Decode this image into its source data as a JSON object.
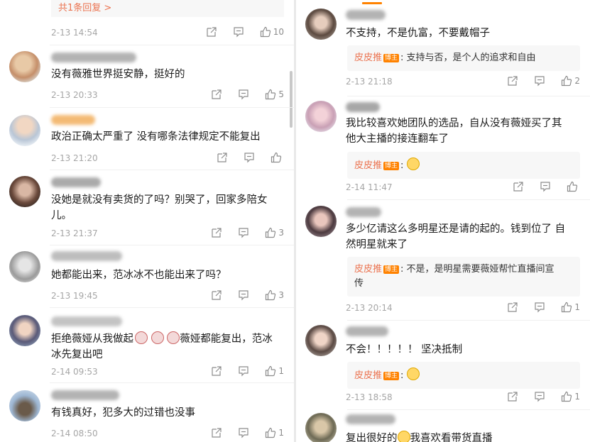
{
  "left": {
    "top_reply_more": "共1条回复 >",
    "top_meta": {
      "time": "2-13 14:54",
      "likes": "10"
    },
    "comments": [
      {
        "text": "没有薇雅世界挺安静，挺好的",
        "time": "2-13 20:33",
        "likes": "5"
      },
      {
        "text": "政治正确太严重了 没有哪条法律规定不能复出",
        "time": "2-13 21:20",
        "likes": ""
      },
      {
        "text": "没她是就没有卖货的了吗？别哭了，回家多陪女\n儿。",
        "time": "2-13 21:37",
        "likes": "3"
      },
      {
        "text": "她都能出来，范冰冰不也能出来了吗？",
        "time": "2-13 19:45",
        "likes": "3"
      },
      {
        "text_pre": "拒绝薇娅从我做起",
        "text_post": "薇娅都能复出，范冰\n冰先复出吧",
        "time": "2-14 09:53",
        "likes": "1"
      },
      {
        "text": "有钱真好，犯多大的过错也没事",
        "time": "2-14 08:50",
        "likes": "1"
      }
    ]
  },
  "right": {
    "comments": [
      {
        "text": "不支持，不是仇富，不要戴帽子",
        "reply_name": "皮皮推",
        "reply_text": "支持与否，是个人的追求和自由",
        "time": "2-13 21:18",
        "likes": "2"
      },
      {
        "text": "我比较喜欢她团队的选品，自从没有薇娅买了其\n他大主播的接连翻车了",
        "reply_name": "皮皮推",
        "reply_text": "",
        "time": "2-14 11:47",
        "likes": ""
      },
      {
        "text": "多少亿请这么多明星还是请的起的。钱到位了 自\n然明星就来了",
        "reply_name": "皮皮推",
        "reply_text": "不是，是明星需要薇娅帮忙直播间宣\n传",
        "time": "2-13 20:14",
        "likes": "1"
      },
      {
        "text": "不会！！！！！ 坚决抵制",
        "reply_name": "皮皮推",
        "reply_text": "",
        "time": "2-13 18:58",
        "likes": "1"
      },
      {
        "text_pre": "复出很好的",
        "text_post": "我喜欢看带货直播",
        "time": "",
        "likes": ""
      }
    ],
    "badge": "博主"
  },
  "icons": {
    "share": "share-icon",
    "comment": "comment-icon",
    "like": "like-icon"
  },
  "colors": {
    "accent": "#eb7350",
    "badge": "#ff8200",
    "meta": "#a6a6a6"
  }
}
